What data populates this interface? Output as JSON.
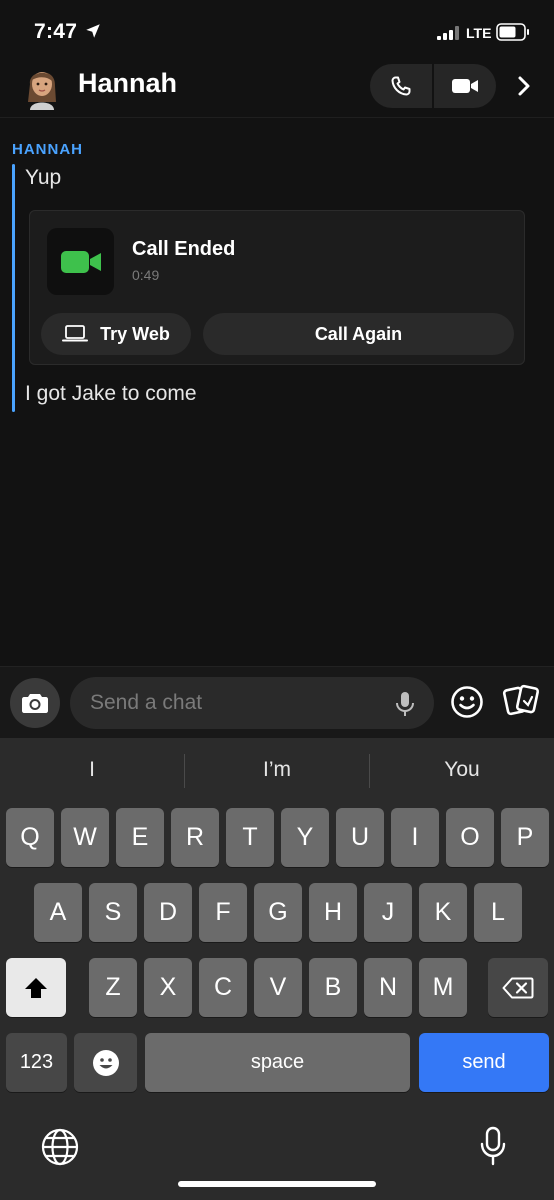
{
  "status_bar": {
    "time": "7:47",
    "network": "LTE",
    "icons": [
      "location-arrow-icon",
      "signal-icon",
      "battery-icon"
    ]
  },
  "header": {
    "contact_name": "Hannah",
    "avatar_icon": "bitmoji-avatar",
    "actions": [
      "phone-icon",
      "video-icon",
      "chevron-right-icon"
    ]
  },
  "chat": {
    "sender": "HANNAH",
    "accent_color": "#4aa3ff",
    "messages": [
      {
        "text": "Yup"
      },
      {
        "text": "I got Jake to come"
      }
    ],
    "call_card": {
      "title": "Call Ended",
      "duration": "0:49",
      "icon": "video-camera-icon",
      "icon_color": "#3ec14c",
      "try_web_label": "Try Web",
      "call_again_label": "Call Again"
    }
  },
  "composer": {
    "placeholder": "Send a chat",
    "icons": [
      "camera-icon",
      "microphone-icon",
      "emoji-icon",
      "cards-icon"
    ]
  },
  "keyboard": {
    "suggestions": [
      "I",
      "I’m",
      "You"
    ],
    "row1": [
      "Q",
      "W",
      "E",
      "R",
      "T",
      "Y",
      "U",
      "I",
      "O",
      "P"
    ],
    "row2": [
      "A",
      "S",
      "D",
      "F",
      "G",
      "H",
      "J",
      "K",
      "L"
    ],
    "row3": [
      "Z",
      "X",
      "C",
      "V",
      "B",
      "N",
      "M"
    ],
    "numbers_label": "123",
    "space_label": "space",
    "send_label": "send",
    "send_color": "#3478f6"
  }
}
